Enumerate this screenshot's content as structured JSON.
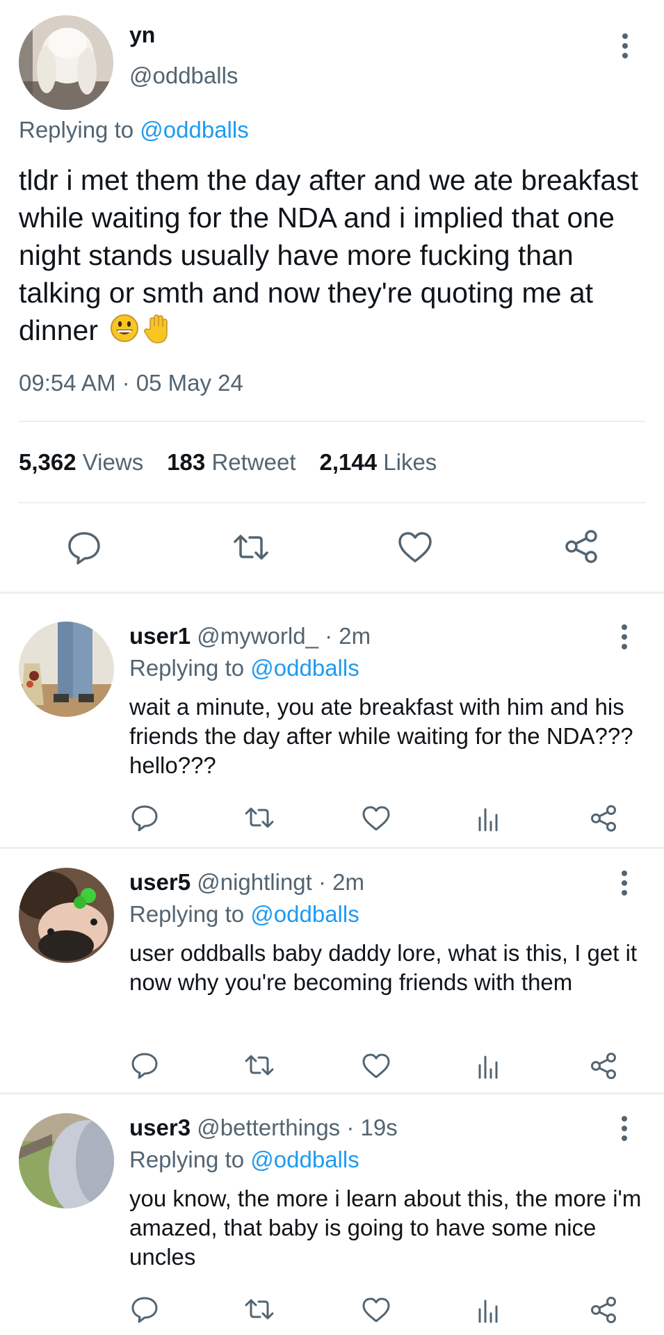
{
  "main_tweet": {
    "display_name": "yn",
    "handle": "@oddballs",
    "replying_prefix": "Replying to",
    "replying_handle": "@oddballs",
    "text": "tldr i met them the day after and we ate breakfast while waiting for the NDA and i implied that one night stands usually have more fucking than talking or smth and now they're quoting me at dinner",
    "emojis": [
      "grinning-face-emoji",
      "raised-hand-emoji"
    ],
    "timestamp": "09:54 AM · 05 May 24",
    "stats": {
      "views_count": "5,362",
      "views_label": "Views",
      "retweets_count": "183",
      "retweets_label": "Retweet",
      "likes_count": "2,144",
      "likes_label": "Likes"
    },
    "actions": [
      "reply-icon",
      "retweet-icon",
      "like-icon",
      "share-icon"
    ]
  },
  "replies": [
    {
      "name": "user1",
      "handle": "@myworld_",
      "time": "· 2m",
      "replying_prefix": "Replying to",
      "replying_handle": "@oddballs",
      "text": "wait a minute, you ate breakfast with him and his friends the day after while waiting for the NDA??? hello???"
    },
    {
      "name": "user5",
      "handle": "@nightlingt",
      "time": "· 2m",
      "replying_prefix": "Replying to",
      "replying_handle": "@oddballs",
      "text": "user oddballs baby daddy lore, what is this, I get it now why you're becoming friends with them"
    },
    {
      "name": "user3",
      "handle": "@betterthings",
      "time": "· 19s",
      "replying_prefix": "Replying to",
      "replying_handle": "@oddballs",
      "text": "you know, the more i learn about this, the more i'm amazed, that baby is going to have some nice uncles"
    }
  ],
  "colors": {
    "link": "#1d9bf0",
    "text": "#0f1419",
    "secondary": "#536471",
    "divider": "#eceff1"
  }
}
